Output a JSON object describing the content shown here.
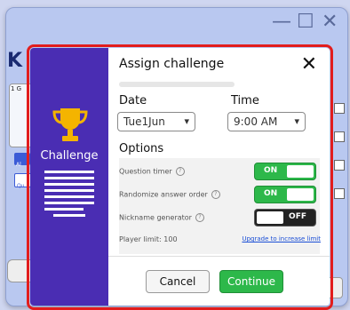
{
  "background": {
    "window_controls": [
      "—",
      "☐",
      "✕"
    ],
    "logo": "K",
    "panel_label": "1 G",
    "chip_label": "Al",
    "chip2_label": "Qu"
  },
  "dialog": {
    "sidebar_title": "Challenge",
    "title": "Assign challenge",
    "close": "✕",
    "date_label": "Date",
    "date_value": "Tue1Jun",
    "time_label": "Time",
    "time_value": "9:00 AM",
    "options_title": "Options",
    "options": [
      {
        "label": "Question timer",
        "state": "ON"
      },
      {
        "label": "Randomize answer order",
        "state": "ON"
      },
      {
        "label": "Nickname generator",
        "state": "OFF"
      }
    ],
    "player_limit": "Player limit: 100",
    "upgrade_link": "Upgrade to increase limit",
    "cancel": "Cancel",
    "continue": "Continue"
  },
  "colors": {
    "sidebar": "#4a2db3",
    "highlight": "#e21d1d",
    "toggle_on": "#2db84a",
    "toggle_off": "#222222",
    "link": "#1b4fd6"
  }
}
